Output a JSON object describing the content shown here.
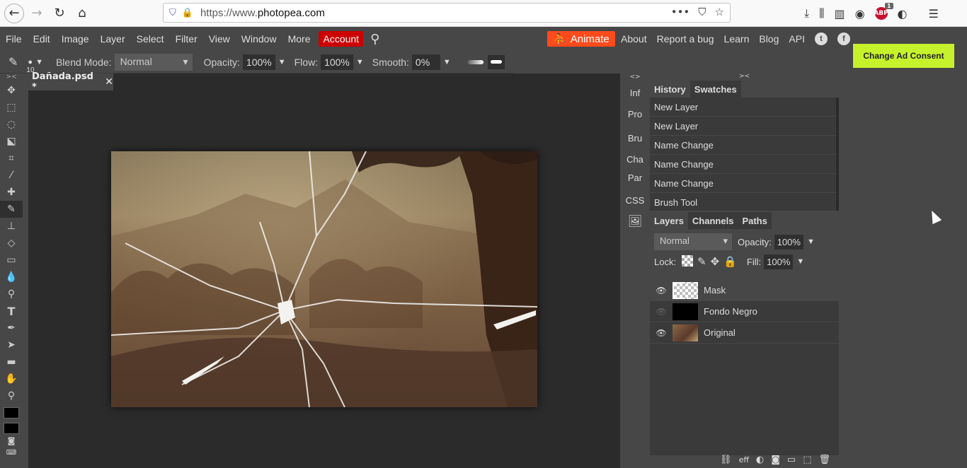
{
  "browser": {
    "url_prefix": "https://www.",
    "url_domain": "photopea.com"
  },
  "menu": {
    "items": [
      "File",
      "Edit",
      "Image",
      "Layer",
      "Select",
      "Filter",
      "View",
      "Window",
      "More"
    ],
    "account": "Account",
    "animate": "Animate",
    "links": [
      "About",
      "Report a bug",
      "Learn",
      "Blog",
      "API"
    ]
  },
  "ad": {
    "consent": "Change Ad Consent"
  },
  "options": {
    "brush_size": "10",
    "blend_label": "Blend Mode:",
    "blend_value": "Normal",
    "opacity_label": "Opacity:",
    "opacity_value": "100%",
    "flow_label": "Flow:",
    "flow_value": "100%",
    "smooth_label": "Smooth:",
    "smooth_value": "0%"
  },
  "document": {
    "tab_title": "Dañada.psd *"
  },
  "mini_panel": {
    "items": [
      "Inf",
      "Pro",
      "Bru",
      "Cha",
      "Par",
      "CSS"
    ]
  },
  "history": {
    "tabs": [
      "History",
      "Swatches"
    ],
    "items": [
      "New Layer",
      "New Layer",
      "Name Change",
      "Name Change",
      "Name Change",
      "Brush Tool"
    ]
  },
  "layers": {
    "tabs": [
      "Layers",
      "Channels",
      "Paths"
    ],
    "blend_value": "Normal",
    "opacity_label": "Opacity:",
    "opacity_value": "100%",
    "lock_label": "Lock:",
    "fill_label": "Fill:",
    "fill_value": "100%",
    "items": [
      {
        "name": "Mask",
        "visible": true
      },
      {
        "name": "Fondo Negro",
        "visible": false
      },
      {
        "name": "Original",
        "visible": true
      }
    ],
    "footer_eff": "eff"
  }
}
